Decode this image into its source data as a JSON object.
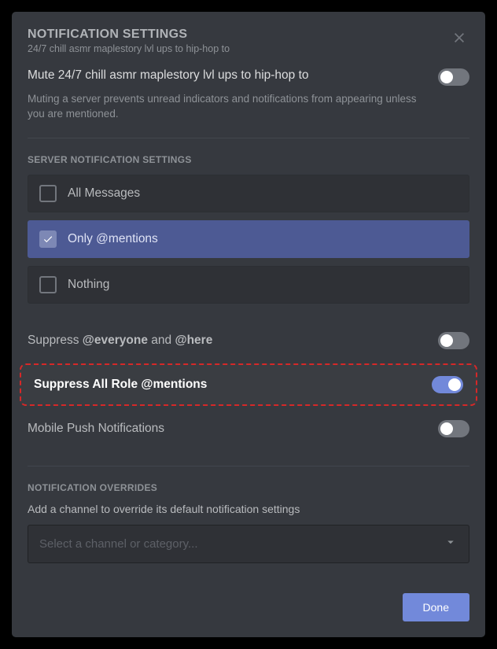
{
  "header": {
    "title": "NOTIFICATION SETTINGS",
    "subtitle": "24/7 chill asmr maplestory lvl ups to hip-hop to"
  },
  "mute": {
    "prefix": "Mute ",
    "server_name": "24/7 chill asmr maplestory lvl ups to hip-hop to",
    "description": "Muting a server prevents unread indicators and notifications from appearing unless you are mentioned.",
    "enabled": false
  },
  "server_notification": {
    "section_label": "SERVER NOTIFICATION SETTINGS",
    "options": {
      "all": "All Messages",
      "mentions": "Only @mentions",
      "nothing": "Nothing"
    },
    "selected": "mentions"
  },
  "suppress_everyone": {
    "prefix": "Suppress ",
    "part1": "@everyone",
    "mid": " and ",
    "part2": "@here",
    "enabled": false
  },
  "suppress_roles": {
    "label": "Suppress All Role @mentions",
    "enabled": true
  },
  "mobile_push": {
    "label": "Mobile Push Notifications",
    "enabled": false
  },
  "overrides": {
    "section_label": "NOTIFICATION OVERRIDES",
    "description": "Add a channel to override its default notification settings",
    "placeholder": "Select a channel or category..."
  },
  "footer": {
    "done": "Done"
  }
}
